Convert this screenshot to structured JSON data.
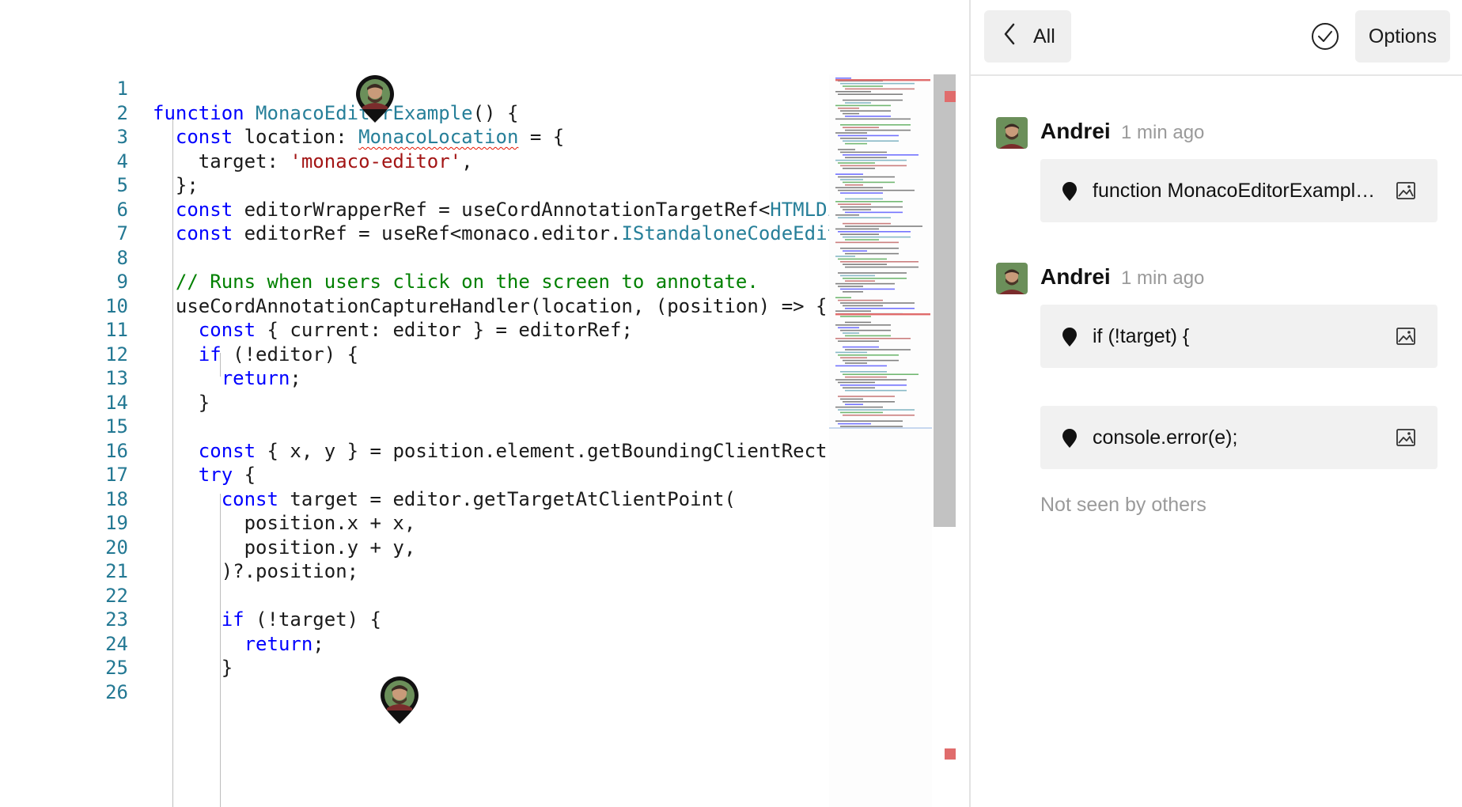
{
  "editor": {
    "lines": [
      {
        "n": "1",
        "parts": []
      },
      {
        "n": "2",
        "parts": [
          [
            "kw",
            "function"
          ],
          [
            "",
            " "
          ],
          [
            "ty",
            "MonacoEditorExample"
          ],
          [
            "",
            "() {"
          ]
        ]
      },
      {
        "n": "3",
        "parts": [
          [
            "",
            "  "
          ],
          [
            "kw",
            "const"
          ],
          [
            "",
            " location: "
          ],
          [
            "ty sq",
            "MonacoLocation"
          ],
          [
            "",
            " = {"
          ]
        ]
      },
      {
        "n": "4",
        "parts": [
          [
            "",
            "    target: "
          ],
          [
            "str",
            "'monaco-editor'"
          ],
          [
            "",
            ","
          ]
        ]
      },
      {
        "n": "5",
        "parts": [
          [
            "",
            "  };"
          ]
        ]
      },
      {
        "n": "6",
        "parts": [
          [
            "",
            "  "
          ],
          [
            "kw",
            "const"
          ],
          [
            "",
            " editorWrapperRef = useCordAnnotationTargetRef<"
          ],
          [
            "ty",
            "HTMLDivElement"
          ],
          [
            "",
            ">("
          ]
        ]
      },
      {
        "n": "7",
        "parts": [
          [
            "",
            "  "
          ],
          [
            "kw",
            "const"
          ],
          [
            "",
            " editorRef = useRef<monaco.editor."
          ],
          [
            "ty",
            "IStandaloneCodeEditor"
          ],
          [
            "",
            ">();"
          ]
        ]
      },
      {
        "n": "8",
        "parts": []
      },
      {
        "n": "9",
        "parts": [
          [
            "cm",
            "  // Runs when users click on the screen to annotate."
          ]
        ]
      },
      {
        "n": "10",
        "parts": [
          [
            "",
            "  useCordAnnotationCaptureHandler(location, (position) => {"
          ]
        ]
      },
      {
        "n": "11",
        "parts": [
          [
            "",
            "    "
          ],
          [
            "kw",
            "const"
          ],
          [
            "",
            " { current: editor } = editorRef;"
          ]
        ]
      },
      {
        "n": "12",
        "parts": [
          [
            "",
            "    "
          ],
          [
            "kw",
            "if"
          ],
          [
            "",
            " (!editor) {"
          ]
        ]
      },
      {
        "n": "13",
        "parts": [
          [
            "",
            "      "
          ],
          [
            "kw",
            "return"
          ],
          [
            "",
            ";"
          ]
        ]
      },
      {
        "n": "14",
        "parts": [
          [
            "",
            "    }"
          ]
        ]
      },
      {
        "n": "15",
        "parts": []
      },
      {
        "n": "16",
        "parts": [
          [
            "",
            "    "
          ],
          [
            "kw",
            "const"
          ],
          [
            "",
            " { x, y } = position.element.getBoundingClientRect();"
          ]
        ]
      },
      {
        "n": "17",
        "parts": [
          [
            "",
            "    "
          ],
          [
            "kw",
            "try"
          ],
          [
            "",
            " {"
          ]
        ]
      },
      {
        "n": "18",
        "parts": [
          [
            "",
            "      "
          ],
          [
            "kw",
            "const"
          ],
          [
            "",
            " target = editor.getTargetAtClientPoint("
          ]
        ]
      },
      {
        "n": "19",
        "parts": [
          [
            "",
            "        position.x + x,"
          ]
        ]
      },
      {
        "n": "20",
        "parts": [
          [
            "",
            "        position.y + y,"
          ]
        ]
      },
      {
        "n": "21",
        "parts": [
          [
            "",
            "      )?.position;"
          ]
        ]
      },
      {
        "n": "22",
        "parts": []
      },
      {
        "n": "23",
        "parts": [
          [
            "",
            "      "
          ],
          [
            "kw",
            "if"
          ],
          [
            "",
            " (!target) {"
          ]
        ]
      },
      {
        "n": "24",
        "parts": [
          [
            "",
            "        "
          ],
          [
            "kw",
            "return"
          ],
          [
            "",
            ";"
          ]
        ]
      },
      {
        "n": "25",
        "parts": [
          [
            "",
            "      }"
          ]
        ]
      },
      {
        "n": "26",
        "parts": []
      }
    ]
  },
  "sidebar": {
    "back_label": "All",
    "options_label": "Options",
    "threads": [
      {
        "author": "Andrei",
        "time": "1 min ago",
        "annotations": [
          "function MonacoEditorExample() {"
        ]
      },
      {
        "author": "Andrei",
        "time": "1 min ago",
        "annotations": [
          "if (!target) {",
          "console.error(e);"
        ]
      }
    ],
    "footer": "Not seen by others"
  },
  "colors": {
    "keyword": "#0000ff",
    "type": "#267f99",
    "string": "#a31515",
    "comment": "#008000",
    "line_number": "#237893",
    "error_squiggle": "#e51400",
    "button_bg": "#efefef"
  },
  "icons": [
    "chevron-left-icon",
    "check-circle-icon",
    "pin-icon",
    "image-icon",
    "avatar"
  ]
}
